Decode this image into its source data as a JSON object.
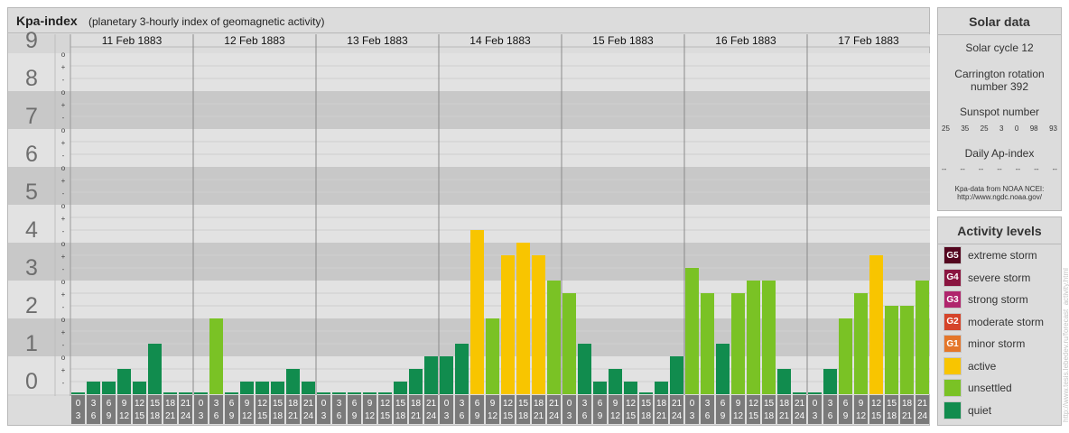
{
  "header": {
    "title": "Kpa-index",
    "subtitle": "(planetary 3-hourly index of geomagnetic activity)"
  },
  "colors": {
    "background": "#dcdcdc",
    "band_dark": "#c8c8c8",
    "band_light": "#e2e2e2",
    "quiet": "#118c4e",
    "unsettled": "#7ac225",
    "active": "#f8c500",
    "minor_storm": "#e4762a",
    "moderate_storm": "#d5442a",
    "strong_storm": "#b0256d",
    "severe_storm": "#8a1540",
    "extreme_storm": "#54061f",
    "tick_box": "#7a7a7a"
  },
  "chart_data": {
    "type": "bar",
    "title": "Kpa-index",
    "subtitle": "(planetary 3-hourly index of geomagnetic activity)",
    "ylim": [
      0,
      9
    ],
    "y_ticks": [
      "0",
      "1",
      "2",
      "3",
      "4",
      "5",
      "6",
      "7",
      "8",
      "9"
    ],
    "y_subticks": [
      "-",
      "+",
      "o"
    ],
    "days": [
      "11 Feb 1883",
      "12 Feb 1883",
      "13 Feb 1883",
      "14 Feb 1883",
      "15 Feb 1883",
      "16 Feb 1883",
      "17 Feb 1883"
    ],
    "x_tick_top": [
      "0",
      "3",
      "6",
      "9",
      "12",
      "15",
      "18",
      "21"
    ],
    "x_tick_bottom": [
      "3",
      "6",
      "9",
      "12",
      "15",
      "18",
      "21",
      "24"
    ],
    "values": [
      [
        0,
        0.333,
        0.333,
        0.667,
        0.333,
        1.333,
        0,
        0
      ],
      [
        0,
        2,
        0,
        0.333,
        0.333,
        0.333,
        0.667,
        0.333
      ],
      [
        0,
        0,
        0,
        0,
        0,
        0.333,
        0.667,
        1
      ],
      [
        1,
        1.333,
        4.333,
        2,
        3.667,
        4,
        3.667,
        3
      ],
      [
        2.667,
        1.333,
        0.333,
        0.667,
        0.333,
        0,
        0.333,
        1
      ],
      [
        3.333,
        2.667,
        1.333,
        2.667,
        3,
        3,
        0.667,
        0
      ],
      [
        0,
        0.667,
        2,
        2.667,
        3.667,
        2.333,
        2.333,
        3
      ]
    ],
    "grid": true
  },
  "solar": {
    "heading": "Solar data",
    "cycle": "Solar cycle 12",
    "carrington_1": "Carrington rotation",
    "carrington_2": "number 392",
    "sunspot_label": "Sunspot number",
    "sunspot_values": [
      "25",
      "35",
      "25",
      "3",
      "0",
      "98",
      "93"
    ],
    "ap_label": "Daily Ap-index",
    "ap_values": [
      "--",
      "--",
      "--",
      "--",
      "--",
      "--",
      "--"
    ],
    "source_1": "Kpa-data from NOAA NCEI:",
    "source_2": "http://www.ngdc.noaa.gov/"
  },
  "activity": {
    "heading": "Activity levels",
    "levels": [
      {
        "code": "G5",
        "label": "extreme storm",
        "color": "#54061f"
      },
      {
        "code": "G4",
        "label": "severe storm",
        "color": "#8a1540"
      },
      {
        "code": "G3",
        "label": "strong storm",
        "color": "#b0256d"
      },
      {
        "code": "G2",
        "label": "moderate storm",
        "color": "#d5442a"
      },
      {
        "code": "G1",
        "label": "minor storm",
        "color": "#e4762a"
      },
      {
        "code": "",
        "label": "active",
        "color": "#f8c500"
      },
      {
        "code": "",
        "label": "unsettled",
        "color": "#7ac225"
      },
      {
        "code": "",
        "label": "quiet",
        "color": "#118c4e"
      }
    ]
  },
  "watermark": "http://www.tesis.lebedev.ru/forecast_activity.html"
}
